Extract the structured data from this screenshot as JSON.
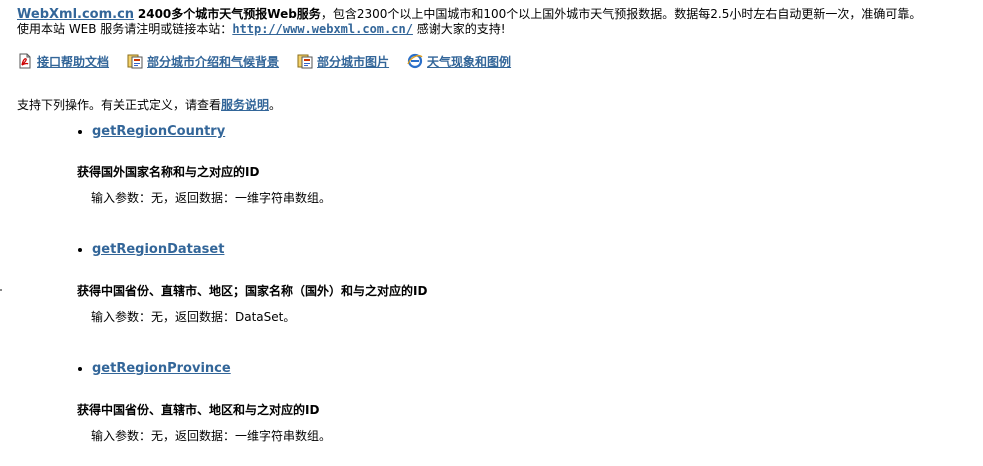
{
  "intro": {
    "site_link": "WebXml.com.cn",
    "headline": "2400多个城市天气预报Web服务",
    "description": "，包含2300个以上中国城市和100个以上国外城市天气预报数据。数据每2.5小时左右自动更新一次，准确可靠。",
    "usage_prefix": "使用本站 WEB 服务请注明或链接本站：",
    "url_link": "http://www.webxml.com.cn/",
    "thanks": " 感谢大家的支持!"
  },
  "nav_links": [
    {
      "label": "接口帮助文档",
      "icon": "pdf-icon"
    },
    {
      "label": "部分城市介绍和气候背景",
      "icon": "document-icon"
    },
    {
      "label": "部分城市图片",
      "icon": "document-icon"
    },
    {
      "label": "天气现象和图例",
      "icon": "ie-icon"
    }
  ],
  "support": {
    "prefix": "支持下列操作。有关正式定义，请查看",
    "link": "服务说明",
    "suffix": "。"
  },
  "operations": [
    {
      "name": "getRegionCountry",
      "description": "获得国外国家名称和与之对应的ID",
      "params": "输入参数：无，返回数据：一维字符串数组。"
    },
    {
      "name": "getRegionDataset",
      "description": "获得中国省份、直辖市、地区；国家名称（国外）和与之对应的ID",
      "params": "输入参数：无，返回数据：DataSet。"
    },
    {
      "name": "getRegionProvince",
      "description": "获得中国省份、直辖市、地区和与之对应的ID",
      "params": "输入参数：无，返回数据：一维字符串数组。"
    }
  ],
  "colors": {
    "link": "#336699",
    "text": "#000000",
    "background": "#ffffff"
  }
}
